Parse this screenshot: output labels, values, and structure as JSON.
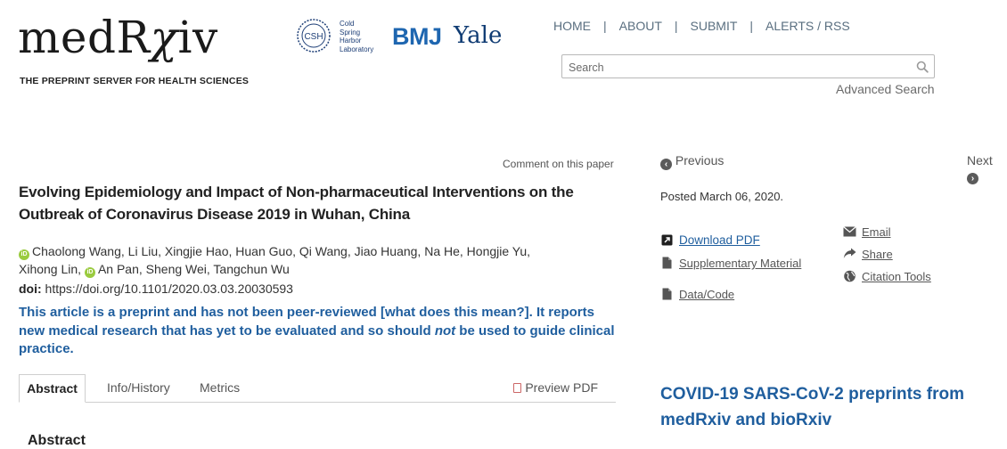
{
  "brand": {
    "logo": "medRχiv",
    "logo_pre": "medR",
    "logo_chi": "χ",
    "logo_post": "iv",
    "tagline": "THE PREPRINT SERVER FOR HEALTH SCIENCES",
    "partners": {
      "csh_badge": "CSH",
      "csh_lines": [
        "Cold",
        "Spring",
        "Harbor",
        "Laboratory"
      ],
      "bmj": "BMJ",
      "yale": "Yale"
    }
  },
  "nav": {
    "items": [
      "HOME",
      "ABOUT",
      "SUBMIT",
      "ALERTS / RSS"
    ],
    "separator": "|"
  },
  "search": {
    "placeholder": "Search",
    "value": "",
    "advanced_label": "Advanced Search"
  },
  "article": {
    "comment_link": "Comment on this paper",
    "title_line1": "Evolving Epidemiology and Impact of Non-pharmaceutical Interventions on the",
    "title_line2": "Outbreak of Coronavirus Disease 2019 in Wuhan, China",
    "authors_a": "Chaolong Wang, Li Liu, Xingjie Hao, Huan Guo, Qi Wang, Jiao Huang, Na He, Hongjie Yu,",
    "authors_b": "Xihong Lin,",
    "authors_c": "An Pan, Sheng Wei, Tangchun Wu",
    "orcid_badge": "iD",
    "doi_label": "doi:",
    "doi_url": "https://doi.org/10.1101/2020.03.03.20030593",
    "notice_a": "This article is a preprint and has not been peer-reviewed [what does this mean?]. It reports new medical research that has yet to be evaluated and so should ",
    "notice_em": "not",
    "notice_b": " be used to guide clinical practice.",
    "tabs": {
      "abstract": "Abstract",
      "info": "Info/History",
      "metrics": "Metrics",
      "preview_pdf": "Preview PDF"
    },
    "abstract_heading": "Abstract"
  },
  "sidebar": {
    "previous": "Previous",
    "next": "Next",
    "posted": "Posted March 06, 2020.",
    "download_pdf": "Download PDF",
    "supplementary": "Supplementary Material",
    "data_code": "Data/Code",
    "email": "Email",
    "share": "Share",
    "citation_tools": "Citation Tools",
    "covid_heading": "COVID-19 SARS-CoV-2 preprints from medRxiv and bioRxiv"
  },
  "colors": {
    "link_blue": "#1f5e9e",
    "bmj_blue": "#1e66b0",
    "yale_blue": "#0f3b73",
    "orcid_green": "#9acb3f",
    "nav_gray": "#5a6f80"
  },
  "icons": {
    "search": "magnifier-icon",
    "previous": "circle-arrow-left-icon",
    "next": "circle-arrow-right-icon",
    "download": "external-link-icon",
    "file": "file-icon",
    "email": "envelope-icon",
    "share": "share-arrow-icon",
    "citation": "globe-icon"
  }
}
